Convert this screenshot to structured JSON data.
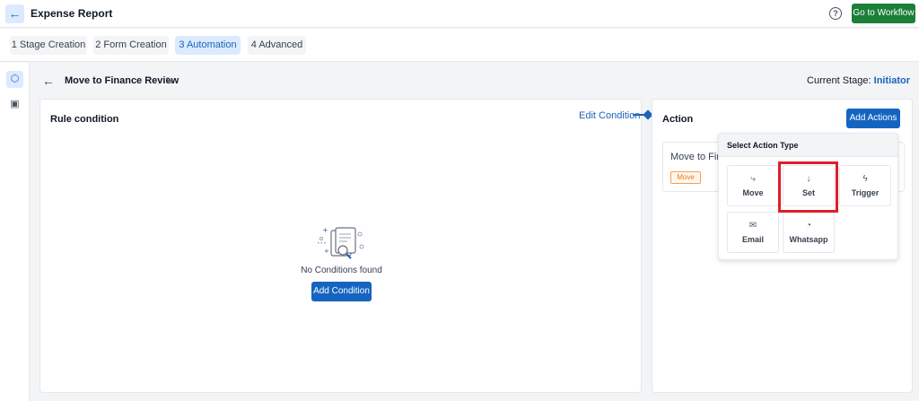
{
  "header": {
    "title": "Expense Report",
    "back_icon": "arrow-left-icon",
    "help_icon": "help-circle-icon",
    "workflow_button": "Go to Workflow"
  },
  "tabs": [
    {
      "label": "1 Stage Creation",
      "active": false
    },
    {
      "label": "2 Form Creation",
      "active": false
    },
    {
      "label": "3 Automation",
      "active": true
    },
    {
      "label": "4 Advanced",
      "active": false
    }
  ],
  "rail": {
    "items": [
      "cube-icon",
      "form-icon"
    ]
  },
  "stage": {
    "name": "Move to Finance Review",
    "current_label": "Current Stage:",
    "current_value": "Initiator"
  },
  "rule": {
    "title": "Rule condition",
    "edit_label": "Edit Condition",
    "empty_text": "No Conditions found",
    "add_label": "Add Condition"
  },
  "action": {
    "title": "Action",
    "add_label": "Add Actions",
    "card_text": "Move to Fina",
    "card_badge": "Move"
  },
  "dropdown": {
    "title": "Select Action Type",
    "options": [
      {
        "label": "Move",
        "icon": "move-icon",
        "glyph": "⤷"
      },
      {
        "label": "Set",
        "icon": "arrow-down-icon",
        "glyph": "↓"
      },
      {
        "label": "Trigger",
        "icon": "lightning-icon",
        "glyph": "ϟ"
      },
      {
        "label": "Email",
        "icon": "mail-icon",
        "glyph": "✉"
      },
      {
        "label": "Whatsapp",
        "icon": "whatsapp-icon",
        "glyph": "◔"
      }
    ],
    "highlighted": "Set"
  },
  "colors": {
    "primary": "#1565c0",
    "success": "#1a7f37",
    "active_tab_bg": "#dbeafe",
    "highlight": "#e11d2a",
    "badge": "#ea7a2a"
  }
}
